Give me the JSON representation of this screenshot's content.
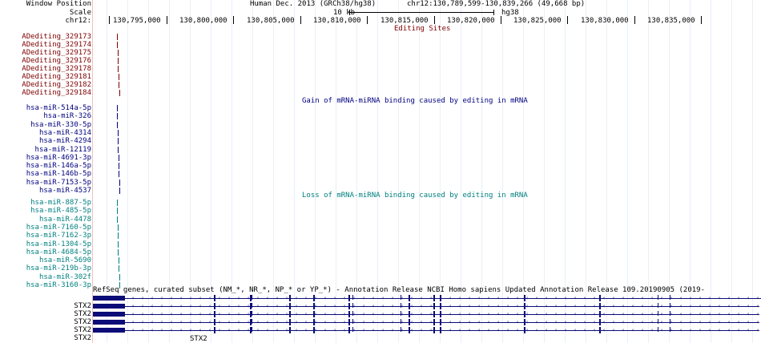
{
  "header": {
    "window_position_label": "Window Position",
    "scale_label": "Scale",
    "chrom_label": "chr12:",
    "assembly": "Human Dec. 2013 (GRCh38/hg38)",
    "position": "chr12:130,789,599-130,839,266 (49,668 bp)",
    "scale_text": "10 kb",
    "scale_db": "hg38"
  },
  "ruler": {
    "ticks": [
      "130,795,000",
      "130,800,000",
      "130,805,000",
      "130,810,000",
      "130,815,000",
      "130,820,000",
      "130,825,000",
      "130,830,000",
      "130,835,000"
    ]
  },
  "tracks": {
    "editing_sites": {
      "title": "Editing Sites",
      "color": "#800000",
      "items": [
        "ADediting_329173",
        "ADediting_329174",
        "ADediting_329175",
        "ADediting_329176",
        "ADediting_329178",
        "ADediting_329181",
        "ADediting_329182",
        "ADediting_329184"
      ]
    },
    "gain": {
      "title": "Gain of mRNA-miRNA binding caused by editing in mRNA",
      "color": "#000080",
      "items": [
        "hsa-miR-514a-5p",
        "hsa-miR-326",
        "hsa-miR-330-5p",
        "hsa-miR-4314",
        "hsa-miR-4294",
        "hsa-miR-12119",
        "hsa-miR-4691-3p",
        "hsa-miR-146a-5p",
        "hsa-miR-146b-5p",
        "hsa-miR-7153-5p",
        "hsa-miR-4537"
      ]
    },
    "loss": {
      "title": "Loss of mRNA-miRNA binding caused by editing in mRNA",
      "color": "#007f7f",
      "items": [
        "hsa-miR-887-5p",
        "hsa-miR-485-5p",
        "hsa-miR-4478",
        "hsa-miR-7160-5p",
        "hsa-miR-7162-3p",
        "hsa-miR-1304-5p",
        "hsa-miR-4684-5p",
        "hsa-miR-5690",
        "hsa-miR-219b-3p",
        "hsa-miR-302f",
        "hsa-miR-3160-3p"
      ]
    },
    "genes": {
      "title": "RefSeq genes, curated subset (NM_*, NR_*, NP_* or YP_*) - Annotation Release NCBI Homo sapiens Updated Annotation Release 109.20190905 (2019-",
      "color": "#0c0c78",
      "items": [
        "STX2",
        "STX2",
        "STX2",
        "STX2",
        "STX2"
      ],
      "bottom_label": "STX2"
    }
  }
}
